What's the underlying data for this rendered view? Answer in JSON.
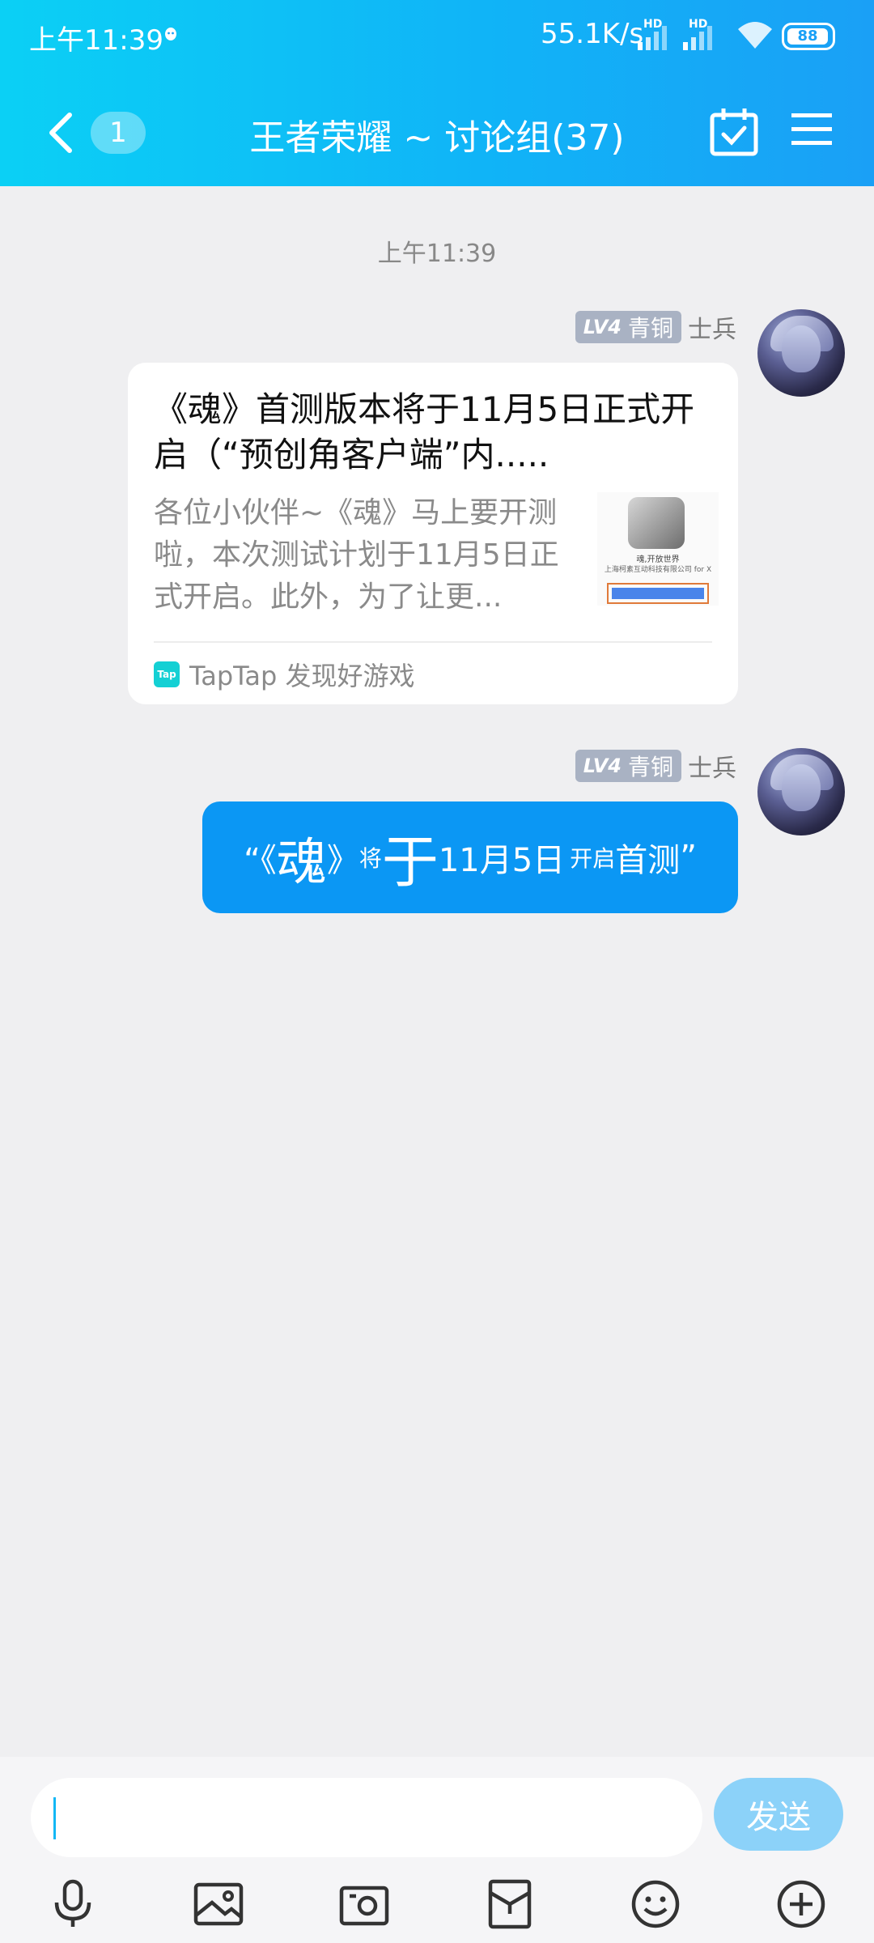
{
  "status_bar": {
    "time": "上午11:39",
    "net_speed": "55.1K/s",
    "hd1": "HD",
    "hd2": "HD",
    "battery": "88"
  },
  "header": {
    "back_badge": "1",
    "title": "王者荣耀 ~ 讨论组(37)"
  },
  "chat": {
    "timestamp": "上午11:39",
    "messages": [
      {
        "level": "LV4",
        "tier": "青铜",
        "rank": "士兵",
        "card": {
          "title": "《魂》首测版本将于11月5日正式开启（“预创角客户端”内.....",
          "description": "各位小伙伴~《魂》马上要开测啦，本次测试计划于11月5日正式开启。此外，为了让更...",
          "thumb_line1": "魂,开放世界",
          "thumb_line2": "上海柯素互动科技有限公司 for X",
          "source": "TapTap 发现好游戏",
          "source_icon_text": "Tap"
        }
      },
      {
        "level": "LV4",
        "tier": "青铜",
        "rank": "士兵",
        "bubble": {
          "p1": "“《",
          "p2": "魂",
          "p3": "》",
          "p4": "将",
          "p5": "于",
          "p6": "11月5日",
          "p7": "开启",
          "p8": "首测",
          "p9": "”"
        }
      }
    ]
  },
  "composer": {
    "input_value": "",
    "send_label": "发送"
  },
  "toolbar_icons": [
    "microphone-icon",
    "image-icon",
    "camera-icon",
    "red-packet-icon",
    "emoji-icon",
    "plus-icon"
  ],
  "colors": {
    "header_gradient_start": "#0bd0f5",
    "header_gradient_end": "#1aa0f6",
    "bubble": "#0b97f4",
    "send_button": "#8cd2f9",
    "background": "#efeff1"
  }
}
